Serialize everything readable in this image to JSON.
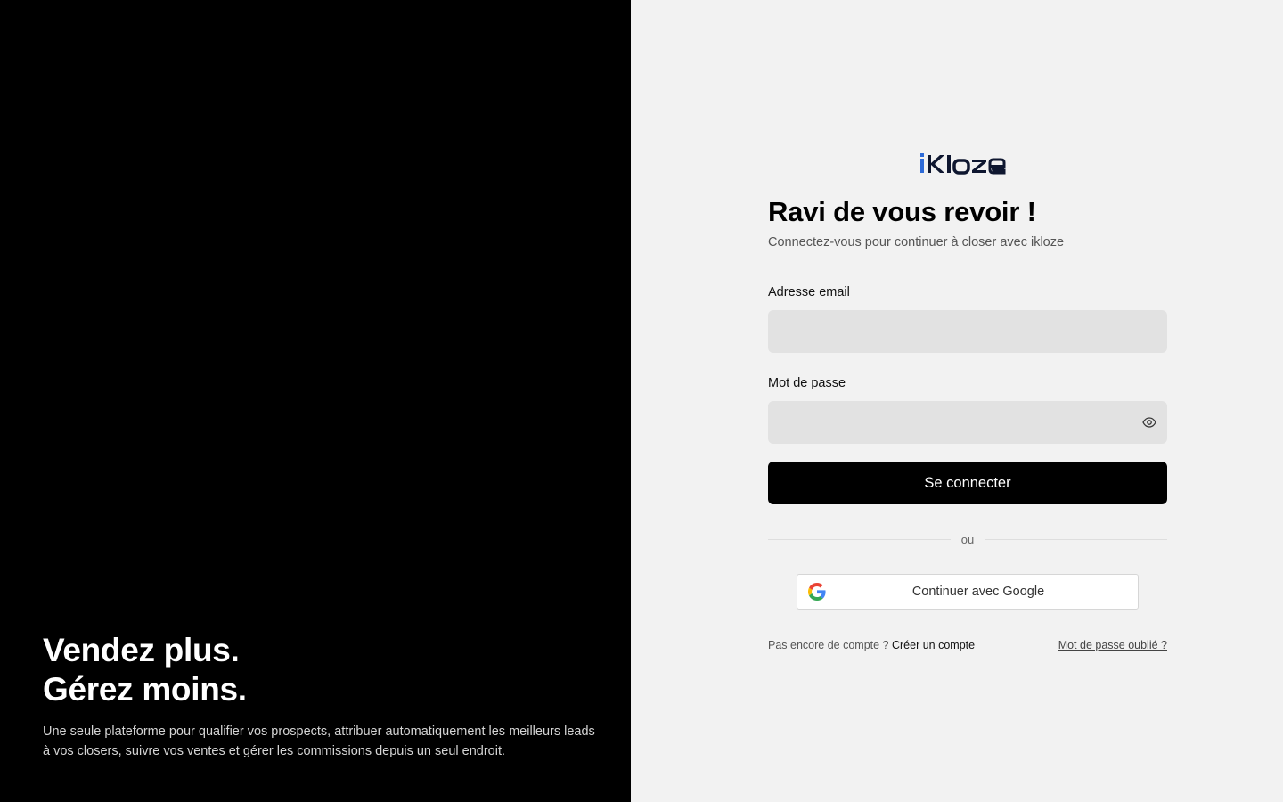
{
  "hero": {
    "title_line1": "Vendez plus.",
    "title_line2": "Gérez moins.",
    "description": "Une seule plateforme pour qualifier vos prospects, attribuer automatiquement les meilleurs leads à vos closers, suivre vos ventes et gérer les commissions depuis un seul endroit."
  },
  "brand": {
    "logo_text": "iKloze",
    "accent_color": "#2e6bd8",
    "dark_color": "#0f1730"
  },
  "login": {
    "title": "Ravi de vous revoir !",
    "subtitle": "Connectez-vous pour continuer à closer avec ikloze",
    "email_label": "Adresse email",
    "email_value": "",
    "password_label": "Mot de passe",
    "password_value": "",
    "password_toggle_icon": "eye-icon",
    "submit_label": "Se connecter",
    "divider_text": "ou",
    "google_label": "Continuer avec Google",
    "google_icon": "google-icon",
    "no_account_text": "Pas encore de compte ?",
    "create_account_link": "Créer un compte",
    "forgot_password_link": "Mot de passe oublié ?"
  }
}
